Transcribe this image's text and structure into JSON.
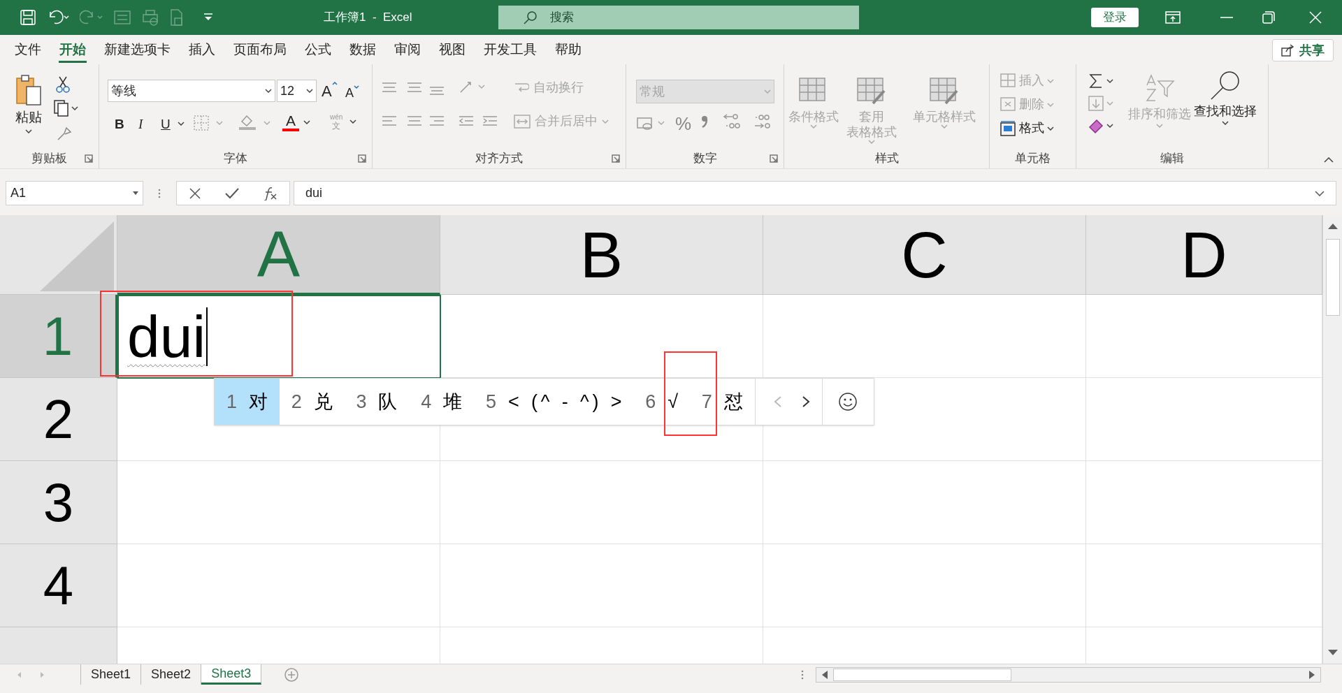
{
  "title_bar": {
    "title": "工作簿1  -  Excel",
    "search_placeholder": "搜索",
    "login": "登录"
  },
  "menu_tabs": [
    {
      "label": "文件",
      "selected": false
    },
    {
      "label": "开始",
      "selected": true
    },
    {
      "label": "新建选项卡",
      "selected": false
    },
    {
      "label": "插入",
      "selected": false
    },
    {
      "label": "页面布局",
      "selected": false
    },
    {
      "label": "公式",
      "selected": false
    },
    {
      "label": "数据",
      "selected": false
    },
    {
      "label": "审阅",
      "selected": false
    },
    {
      "label": "视图",
      "selected": false
    },
    {
      "label": "开发工具",
      "selected": false
    },
    {
      "label": "帮助",
      "selected": false
    }
  ],
  "share": "共享",
  "ribbon": {
    "clipboard": {
      "label": "剪贴板",
      "paste": "粘贴"
    },
    "font": {
      "label": "字体",
      "font_name": "等线",
      "font_size": "12",
      "bold": "B",
      "italic": "I",
      "underline": "U",
      "grow": "A",
      "shrink": "A",
      "font_color": "A",
      "phonetic_top": "wén",
      "phonetic_bottom": "文"
    },
    "alignment": {
      "label": "对齐方式",
      "buttons": [
        {
          "text": "自动换行",
          "disabled": true
        },
        {
          "text": "合并后居中",
          "disabled": true
        }
      ]
    },
    "number": {
      "label": "数字",
      "format": {
        "value": "常规",
        "disabled": true
      },
      "percent": "%"
    },
    "styles": {
      "label": "样式",
      "buttons": [
        {
          "lines": [
            "条件格式"
          ],
          "disabled": true
        },
        {
          "lines": [
            "套用",
            "表格格式"
          ],
          "disabled": true
        },
        {
          "lines": [
            "单元格样式"
          ],
          "disabled": true
        }
      ]
    },
    "cells": {
      "label": "单元格",
      "buttons": [
        {
          "text": "插入",
          "disabled": true
        },
        {
          "text": "删除",
          "disabled": true
        },
        {
          "text": "格式",
          "disabled": false
        }
      ]
    },
    "editing": {
      "label": "编辑",
      "buttons": [
        {
          "text": "排序和筛选",
          "disabled": true
        },
        {
          "text": "查找和选择",
          "disabled": false
        }
      ]
    }
  },
  "formula_bar": {
    "name_box": "A1",
    "value": "dui"
  },
  "columns": [
    {
      "label": "A",
      "selected": true
    },
    {
      "label": "B",
      "selected": false
    },
    {
      "label": "C",
      "selected": false
    },
    {
      "label": "D",
      "selected": false
    }
  ],
  "rows": [
    {
      "label": "1",
      "selected": true
    },
    {
      "label": "2",
      "selected": false
    },
    {
      "label": "3",
      "selected": false
    },
    {
      "label": "4",
      "selected": false
    }
  ],
  "active_cell": {
    "text": "dui"
  },
  "ime_candidates": [
    {
      "index": "1",
      "text": "对",
      "selected": true
    },
    {
      "index": "2",
      "text": "兑",
      "selected": false
    },
    {
      "index": "3",
      "text": "队",
      "selected": false
    },
    {
      "index": "4",
      "text": "堆",
      "selected": false
    },
    {
      "index": "5",
      "text": "< (^ - ^) >",
      "selected": false
    },
    {
      "index": "6",
      "text": "√",
      "selected": false
    },
    {
      "index": "7",
      "text": "怼",
      "selected": false
    }
  ],
  "sheets": [
    {
      "label": "Sheet1",
      "selected": false
    },
    {
      "label": "Sheet2",
      "selected": false
    },
    {
      "label": "Sheet3",
      "selected": true
    }
  ]
}
